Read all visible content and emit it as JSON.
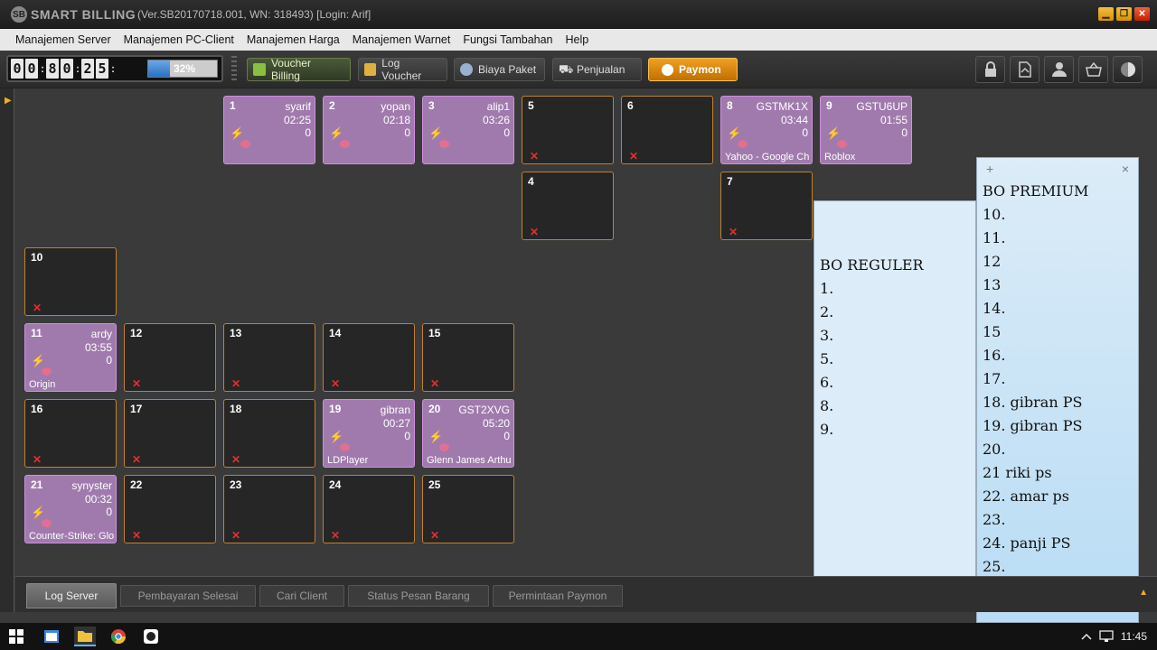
{
  "app": {
    "brand_mark": "SB",
    "brand": "SMART BILLING",
    "title": "(Ver.SB20170718.001, WN: 318493) [Login: Arif]"
  },
  "menu": [
    "Manajemen Server",
    "Manajemen PC-Client",
    "Manajemen Harga",
    "Manajemen Warnet",
    "Fungsi Tambahan",
    "Help"
  ],
  "clock": {
    "digits": [
      "0",
      "0",
      "8",
      "0",
      "2",
      "5"
    ],
    "colon": ":",
    "progress": 0.32,
    "progress_label": "32%"
  },
  "toolbar": {
    "voucher_billing": "Voucher Billing",
    "log_voucher": "Log Voucher",
    "biaya_paket": "Biaya Paket",
    "penjualan": "Penjualan",
    "paymon": "Paymon"
  },
  "tiles": [
    {
      "id": "1",
      "user": "syarif",
      "time": "02:25",
      "amount": "0",
      "app": "",
      "active": true
    },
    {
      "id": "2",
      "user": "yopan",
      "time": "02:18",
      "amount": "0",
      "app": "",
      "active": true
    },
    {
      "id": "3",
      "user": "alip1",
      "time": "03:26",
      "amount": "0",
      "app": "",
      "active": true
    },
    {
      "id": "5",
      "active": false
    },
    {
      "id": "6",
      "active": false
    },
    {
      "id": "8",
      "user": "GSTMK1X",
      "time": "03:44",
      "amount": "0",
      "app": "Yahoo - Google Ch",
      "active": true
    },
    {
      "id": "9",
      "user": "GSTU6UP",
      "time": "01:55",
      "amount": "0",
      "app": "Roblox",
      "active": true
    },
    {
      "id": "4",
      "active": false
    },
    {
      "id": "7",
      "active": false
    },
    {
      "id": "10",
      "active": false
    },
    {
      "id": "11",
      "user": "ardy",
      "time": "03:55",
      "amount": "0",
      "app": "Origin",
      "active": true
    },
    {
      "id": "12",
      "active": false
    },
    {
      "id": "13",
      "active": false
    },
    {
      "id": "14",
      "active": false
    },
    {
      "id": "15",
      "active": false
    },
    {
      "id": "16",
      "active": false
    },
    {
      "id": "17",
      "active": false
    },
    {
      "id": "18",
      "active": false
    },
    {
      "id": "19",
      "user": "gibran",
      "time": "00:27",
      "amount": "0",
      "app": "LDPlayer",
      "active": true
    },
    {
      "id": "20",
      "user": "GST2XVG",
      "time": "05:20",
      "amount": "0",
      "app": "Glenn James Arthu",
      "active": true
    },
    {
      "id": "21",
      "user": "synyster",
      "time": "00:32",
      "amount": "0",
      "app": "Counter-Strike: Glo",
      "active": true
    },
    {
      "id": "22",
      "active": false
    },
    {
      "id": "23",
      "active": false
    },
    {
      "id": "24",
      "active": false
    },
    {
      "id": "25",
      "active": false
    }
  ],
  "note_reguler": {
    "lines": [
      "BO REGULER",
      "1.",
      "2.",
      "3.",
      "5.",
      "6.",
      "8.",
      "9."
    ]
  },
  "note_premium": {
    "add": "+",
    "close": "×",
    "lines": [
      "BO PREMIUM",
      "10.",
      "11.",
      "12",
      "13",
      "14.",
      "15",
      "16.",
      "17.",
      "18. gibran PS",
      "19. gibran PS",
      "20.",
      "21 riki ps",
      "22. amar ps",
      "23.",
      "24. panji PS",
      "25."
    ]
  },
  "tabs": [
    "Log Server",
    "Pembayaran Selesai",
    "Cari Client",
    "Status Pesan Barang",
    "Permintaan Paymon"
  ],
  "taskbar": {
    "time": "11:45"
  }
}
